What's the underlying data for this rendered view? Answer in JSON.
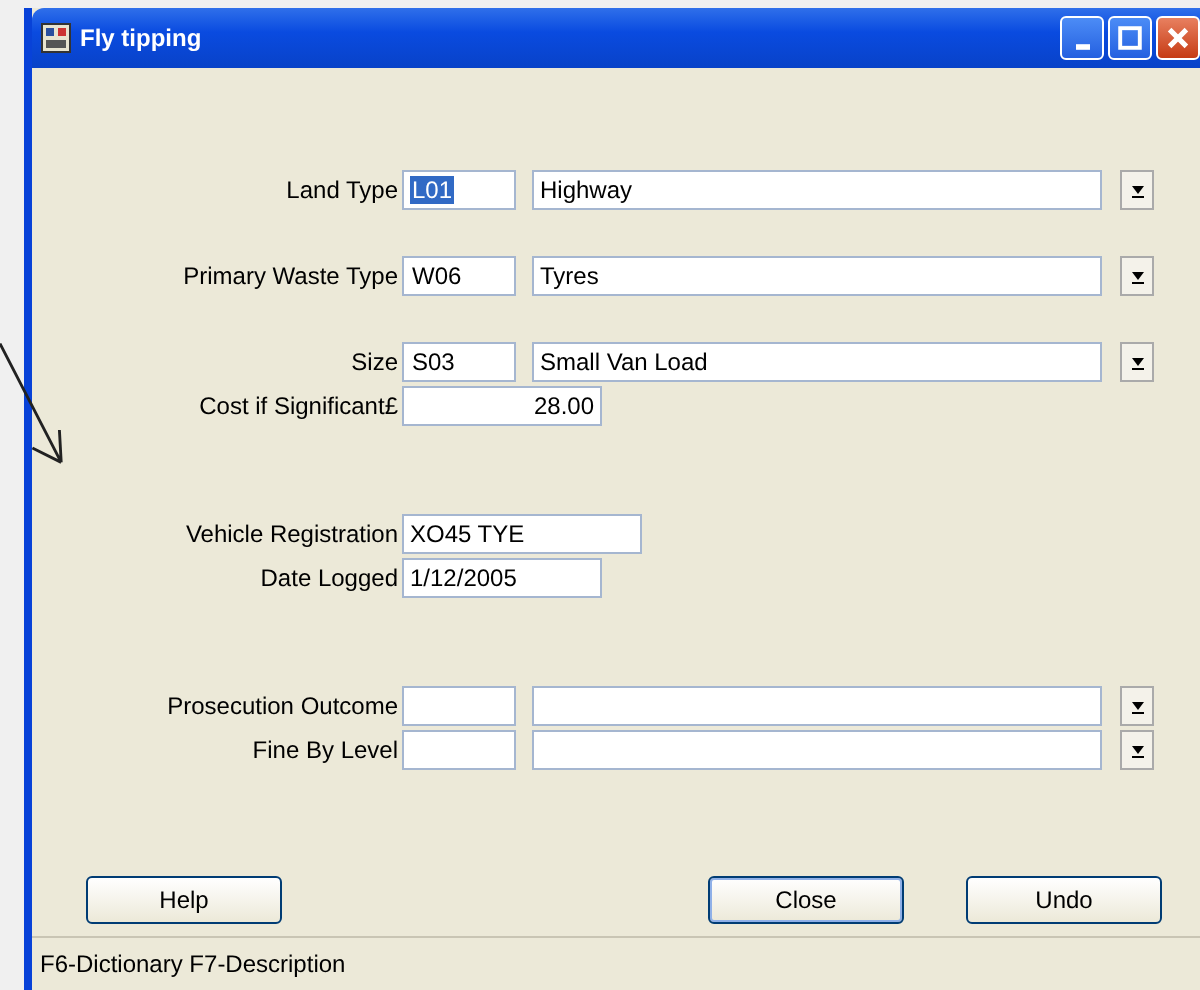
{
  "window": {
    "title": "Fly tipping"
  },
  "sections": [
    [
      {
        "label": "Land Type",
        "kind": "lookup",
        "code": "L01",
        "code_selected": true,
        "description": "Highway"
      }
    ],
    [
      {
        "label": "Primary Waste Type",
        "kind": "lookup",
        "code": "W06",
        "code_selected": false,
        "description": "Tyres"
      }
    ],
    [
      {
        "label": "Size",
        "kind": "lookup",
        "code": "S03",
        "code_selected": false,
        "description": "Small Van Load"
      },
      {
        "label": "Cost if Significant£",
        "kind": "amount",
        "value": "28.00"
      }
    ],
    [
      {
        "label": "Vehicle Registration",
        "kind": "text",
        "value": "XO45 TYE"
      },
      {
        "label": "Date Logged",
        "kind": "text",
        "value": "1/12/2005"
      }
    ],
    [
      {
        "label": "Prosecution Outcome",
        "kind": "lookup"
      },
      {
        "label": "Fine By Level",
        "kind": "lookup"
      }
    ]
  ],
  "buttons": [
    {
      "label": "Help",
      "default": false
    },
    {
      "label": "Close",
      "default": true
    },
    {
      "label": "Undo",
      "default": false
    }
  ],
  "status_bar": "F6-Dictionary F7-Description"
}
